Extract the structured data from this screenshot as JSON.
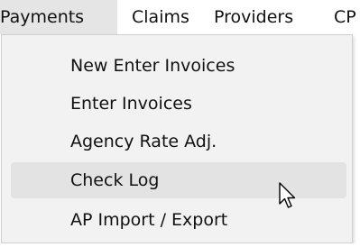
{
  "menubar": {
    "items": [
      {
        "label": "Payments"
      },
      {
        "label": "Claims"
      },
      {
        "label": "Providers"
      },
      {
        "label": "CP"
      }
    ]
  },
  "dropdown": {
    "items": [
      {
        "label": "New Enter Invoices"
      },
      {
        "label": "Enter Invoices"
      },
      {
        "label": "Agency Rate Adj."
      },
      {
        "label": "Check Log"
      },
      {
        "label": "AP Import / Export"
      }
    ],
    "hovered": "Check Log"
  },
  "colors": {
    "menu_background": "#f2f2f2",
    "hover_background": "#e3e3e3",
    "text": "#111111"
  },
  "icons": {
    "cursor": "arrow-cursor-icon"
  }
}
